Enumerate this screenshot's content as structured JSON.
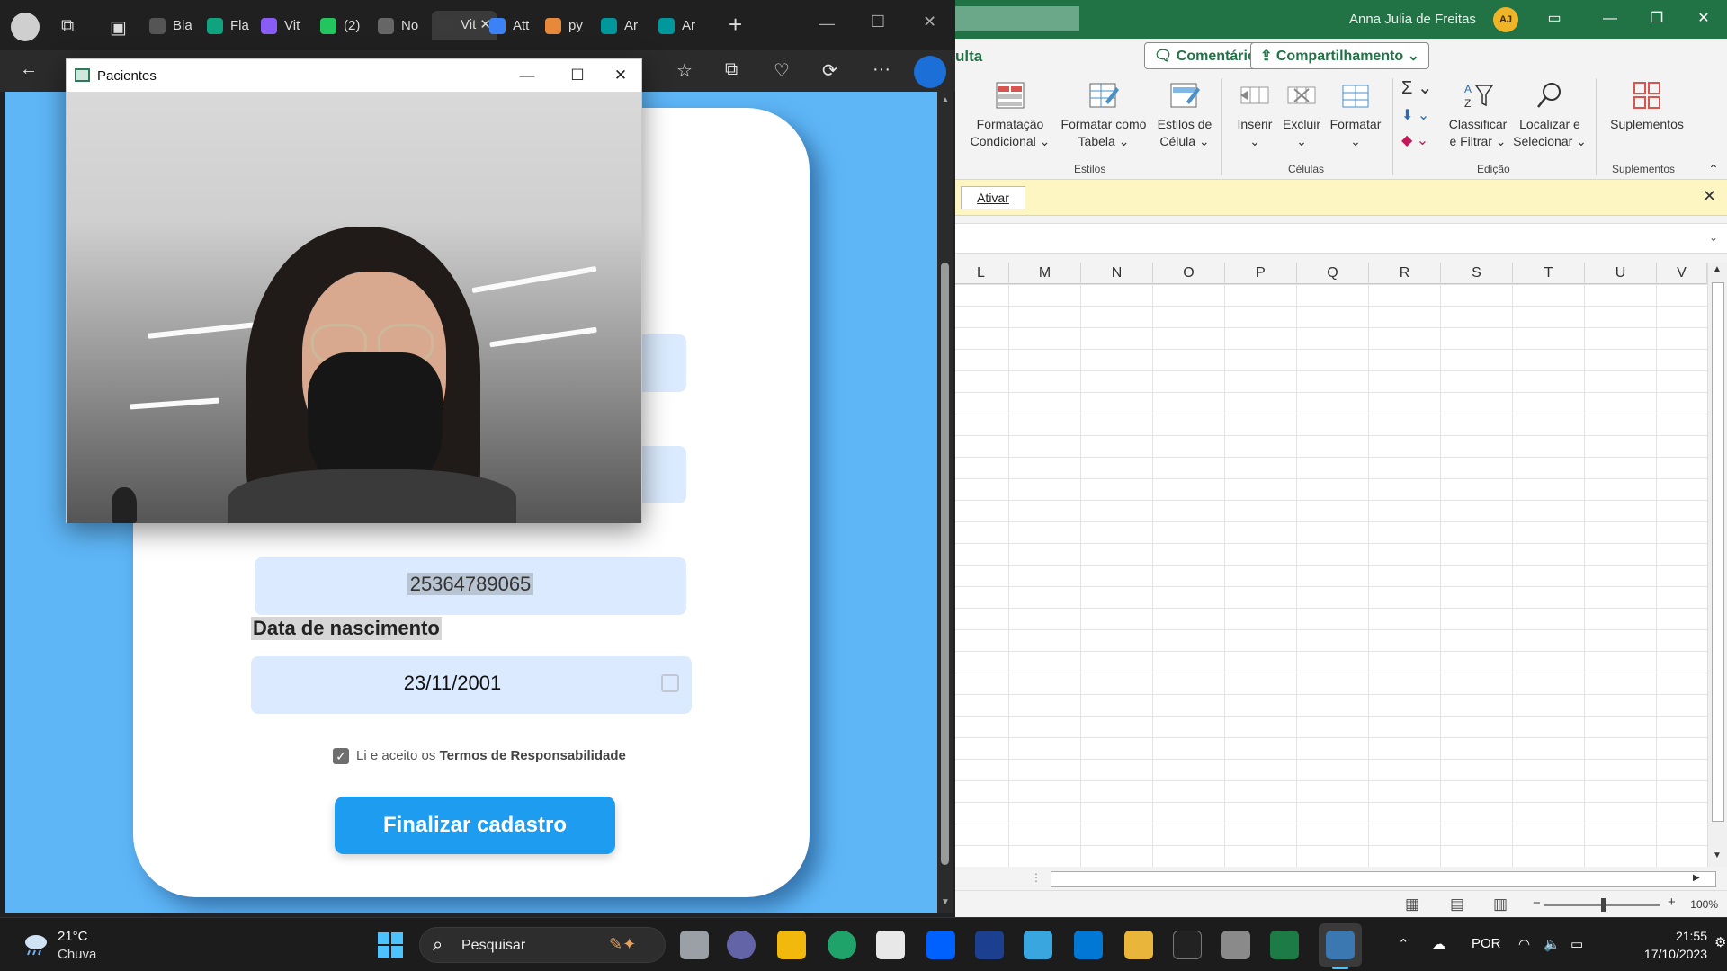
{
  "excel": {
    "user_name": "Anna Julia de Freitas",
    "user_initials": "AJ",
    "tab_fragment": "ulta",
    "comments_label": "Comentários",
    "share_label": "Compartilhamento",
    "ribbon": {
      "conditional_formatting": [
        "Formatação",
        "Condicional"
      ],
      "format_as_table": [
        "Formatar como",
        "Tabela"
      ],
      "cell_styles": [
        "Estilos de",
        "Célula"
      ],
      "insert": "Inserir",
      "delete": "Excluir",
      "format": "Formatar",
      "sort_filter": [
        "Classificar",
        "e Filtrar"
      ],
      "find_select": [
        "Localizar e",
        "Selecionar"
      ],
      "addins": "Suplementos",
      "groups": {
        "styles": "Estilos",
        "cells": "Células",
        "editing": "Edição",
        "addins": "Suplementos"
      }
    },
    "message_bar": {
      "activate_label": "Ativar"
    },
    "columns": [
      "L",
      "M",
      "N",
      "O",
      "P",
      "Q",
      "R",
      "S",
      "T",
      "U",
      "V"
    ],
    "zoom": "100%"
  },
  "browser": {
    "tabs": [
      "Bla",
      "Fla",
      "Vit",
      "(2)",
      "No",
      "Vit",
      "Att",
      "py",
      "Ar",
      "Ar"
    ],
    "form": {
      "cpf_value": "25364789065",
      "dob_label": "Data de nascimento",
      "dob_value": "23/11/2001",
      "terms_prefix": "Li e aceito os ",
      "terms_link": "Termos de Responsabilidade",
      "terms_checked": true,
      "submit_label": "Finalizar cadastro"
    }
  },
  "camera_window": {
    "title": "Pacientes"
  },
  "taskbar": {
    "weather_temp": "21°C",
    "weather_desc": "Chuva",
    "search_placeholder": "Pesquisar",
    "language": "POR",
    "time": "21:55",
    "date": "17/10/2023"
  },
  "colors": {
    "excel_green": "#217346",
    "form_background": "#5eb6f7",
    "field_background": "#dbeafe",
    "submit_button": "#1e9cf0",
    "windows_accent": "#4cc2ff"
  }
}
